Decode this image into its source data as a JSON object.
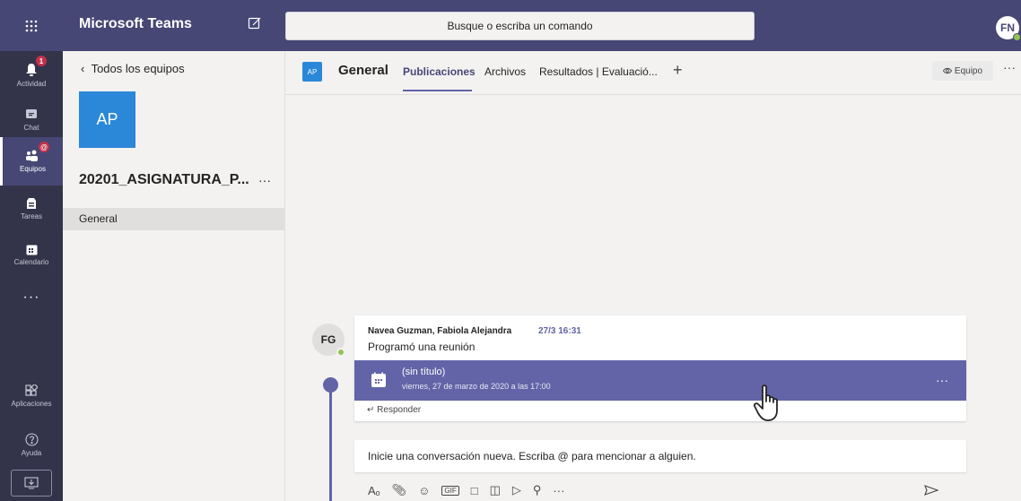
{
  "app": {
    "title": "Microsoft Teams",
    "user_initials": "FN"
  },
  "search": {
    "placeholder": "Busque o escriba un comando"
  },
  "rail": {
    "items": [
      {
        "label": "Actividad",
        "icon": "bell-icon",
        "badge": "1"
      },
      {
        "label": "Chat",
        "icon": "chat-icon"
      },
      {
        "label": "Equipos",
        "icon": "teams-icon",
        "badge": "@"
      },
      {
        "label": "Tareas",
        "icon": "assignments-icon"
      },
      {
        "label": "Calendario",
        "icon": "calendar-icon"
      }
    ],
    "more": "···",
    "apps": "Aplicaciones",
    "help": "Ayuda"
  },
  "team_panel": {
    "back_label": "Todos los equipos",
    "team_initials": "AP",
    "team_name": "20201_ASIGNATURA_P...",
    "more": "···",
    "channel": "General"
  },
  "channel_header": {
    "icon_initials": "AP",
    "title": "General",
    "tabs": [
      "Publicaciones",
      "Archivos",
      "Resultados | Evaluació..."
    ],
    "active_tab": 0,
    "add": "+",
    "team_button": "Equipo",
    "more": "···"
  },
  "post": {
    "avatar": "FG",
    "author": "Navea Guzman, Fabiola Alejandra",
    "timestamp": "27/3 16:31",
    "text": "Programó una reunión",
    "meeting_title": "(sin título)",
    "meeting_date": "viernes, 27 de marzo de 2020 a las 17:00",
    "meeting_more": "···",
    "reply_label": "Responder"
  },
  "composer": {
    "placeholder": "Inicie una conversación nueva. Escriba @ para mencionar a alguien.",
    "more": "···"
  },
  "colors": {
    "accent": "#6264a7",
    "topbar": "#464775",
    "rail": "#33344a",
    "team_avatar": "#2b88d8",
    "badge": "#c4314b",
    "presence": "#92c353"
  }
}
